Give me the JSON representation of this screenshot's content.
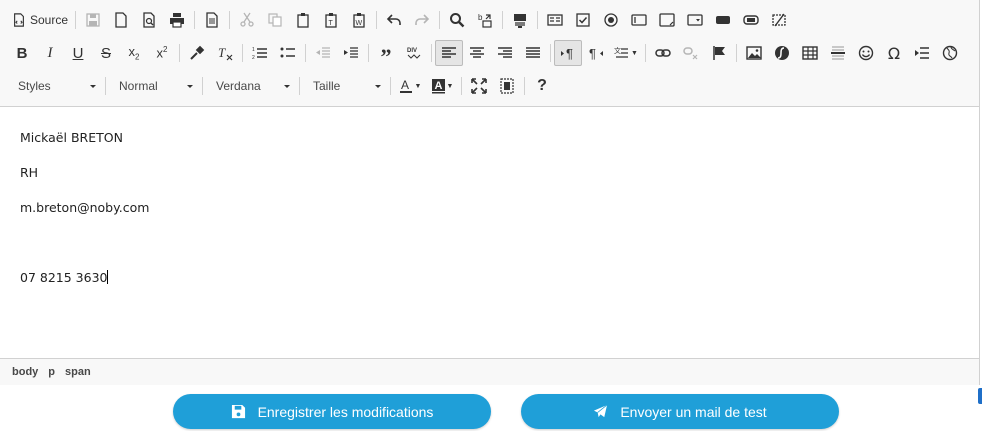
{
  "toolbar": {
    "source_label": "Source",
    "styles_combo": "Styles",
    "format_combo": "Normal",
    "font_combo": "Verdana",
    "size_combo": "Taille"
  },
  "content": {
    "lines": [
      "Mickaël BRETON",
      "RH",
      "m.breton@noby.com",
      "",
      "07 8215 3630"
    ]
  },
  "pathbar": {
    "items": [
      "body",
      "p",
      "span"
    ]
  },
  "actions": {
    "save_label": "Enregistrer les modifications",
    "test_mail_label": "Envoyer un mail de test"
  },
  "colors": {
    "accent": "#1f9fd8",
    "toolbar_bg": "#f8f8f8",
    "border": "#d1d1d1"
  }
}
